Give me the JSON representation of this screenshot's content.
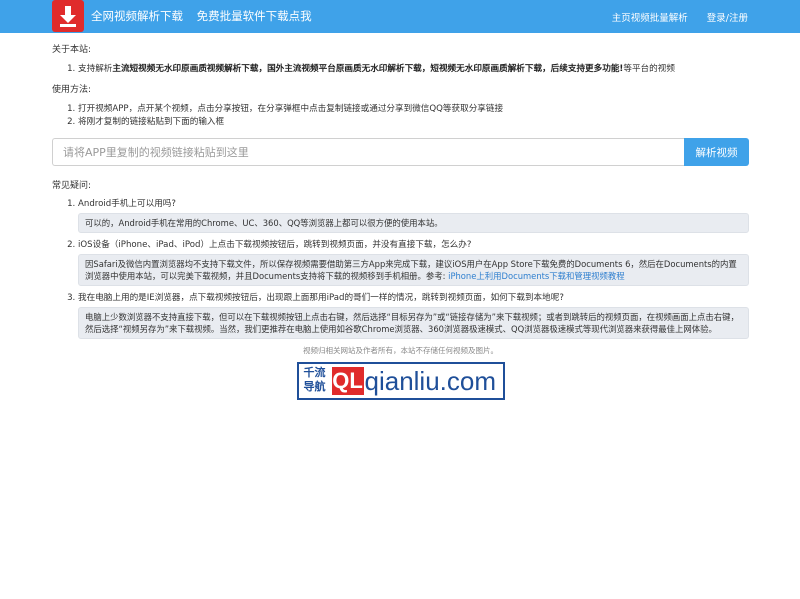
{
  "header": {
    "brand_title": "全网视频解析下载",
    "brand_subtitle": "免费批量软件下载点我",
    "nav": [
      {
        "label": "主页视频批量解析"
      },
      {
        "label": "登录/注册"
      }
    ]
  },
  "about": {
    "title": "关于本站:",
    "item_prefix": "支持解析",
    "item_bold": "主流短视频无水印原画质视频解析下载，国外主流视频平台原画质无水印解析下载，短视频无水印原画质解析下载，后续支持更多功能!",
    "item_suffix": "等平台的视频"
  },
  "usage": {
    "title": "使用方法:",
    "steps": [
      "打开视频APP，点开某个视频，点击分享按钮，在分享弹框中点击复制链接或通过分享到微信QQ等获取分享链接",
      "将刚才复制的链接粘贴到下面的输入框"
    ]
  },
  "search": {
    "placeholder": "请将APP里复制的视频链接粘贴到这里",
    "value": "",
    "button_label": "解析视频"
  },
  "faq": {
    "title": "常见疑问:",
    "items": [
      {
        "question": "Android手机上可以用吗?",
        "answer": "可以的，Android手机在常用的Chrome、UC、360、QQ等浏览器上都可以很方便的使用本站。"
      },
      {
        "question": "iOS设备（iPhone、iPad、iPod）上点击下载视频按钮后，跳转到视频页面，并没有直接下载，怎么办?",
        "answer": "因Safari及微信内置浏览器均不支持下载文件，所以保存视频需要借助第三方App来完成下载，建议iOS用户在App Store下载免费的Documents 6，然后在Documents的内置浏览器中使用本站，可以完美下载视频，并且Documents支持将下载的视频移到手机相册。参考:",
        "link": "iPhone上利用Documents下载和管理视频教程"
      },
      {
        "question": "我在电脑上用的是IE浏览器，点下载视频按钮后，出现跟上面那用iPad的哥们一样的情况，跳转到视频页面，如何下载到本地呢?",
        "answer": "电脑上少数浏览器不支持直接下载，但可以在下载视频按钮上点击右键，然后选择“目标另存为”或“链接存储为”来下载视频；或者到跳转后的视频页面，在视频画面上点击右键，然后选择“视频另存为”来下载视频。当然，我们更推荐在电脑上使用如谷歌Chrome浏览器、360浏览器极速模式、QQ浏览器极速模式等现代浏览器来获得最佳上网体验。"
      }
    ]
  },
  "footer": {
    "note": "视频归相关网站及作者所有，本站不存储任何视频及图片。",
    "logo_cn": "千流导航",
    "logo_ql": "QL",
    "logo_domain": "qianliu.com"
  },
  "colors": {
    "nav_bg": "#3fa2e9",
    "logo_red": "#e02b2b",
    "link_blue": "#2f7fcf",
    "answer_bg": "#e9ecf1"
  },
  "icons": {
    "logo": "download-arrow-icon"
  }
}
